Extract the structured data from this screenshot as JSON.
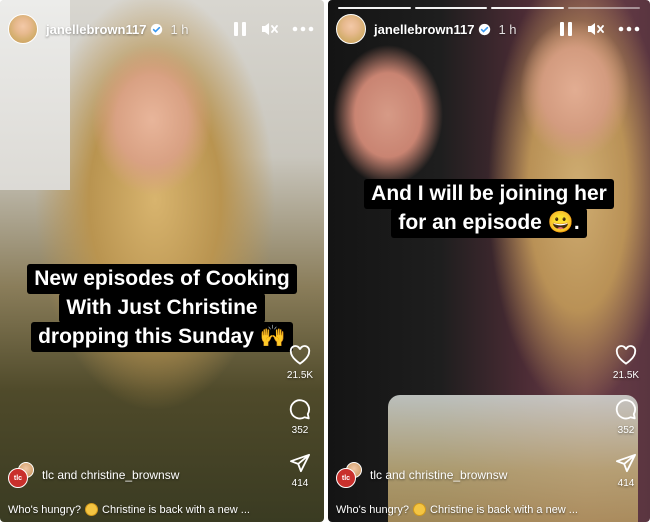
{
  "stories": [
    {
      "username": "janellebrown117",
      "time": "1 h",
      "caption": [
        "New episodes of Cooking",
        "With Just Christine",
        "dropping this Sunday 🙌"
      ],
      "likes": "21.5K",
      "comments": "352",
      "shares": "414",
      "collab": "tlc and christine_brownsw",
      "description_start": "Who's hungry?",
      "description_end": "Christine is back with a new ..."
    },
    {
      "username": "janellebrown117",
      "time": "1 h",
      "caption": [
        "And I will be joining her",
        "for an episode 😀."
      ],
      "likes": "21.5K",
      "comments": "352",
      "shares": "414",
      "collab": "tlc and christine_brownsw",
      "description_start": "Who's hungry?",
      "description_end": "Christine is back with a new ..."
    }
  ],
  "colors": {
    "caption_bg": "#000000",
    "text": "#ffffff",
    "verified": "#3897f0"
  },
  "icons": {
    "pause": "pause-icon",
    "mute": "mute-icon",
    "more": "more-icon",
    "heart": "heart-icon",
    "comment": "comment-icon",
    "share": "share-icon"
  }
}
